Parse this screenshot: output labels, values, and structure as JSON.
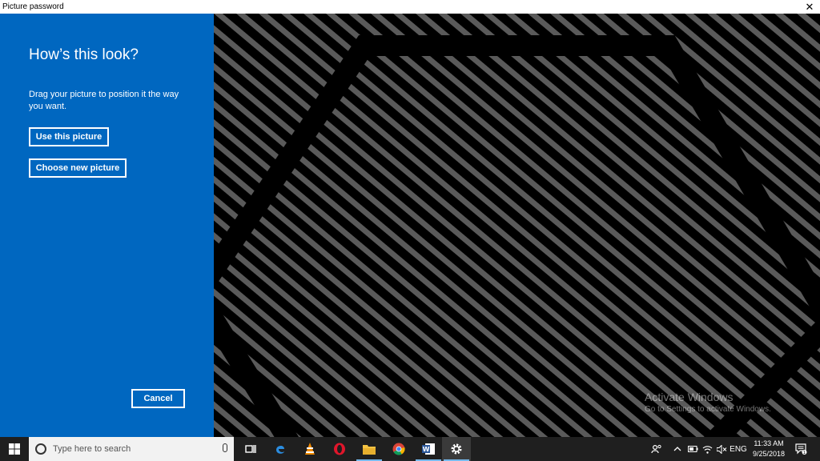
{
  "window": {
    "title": "Picture password"
  },
  "panel": {
    "heading": "How’s this look?",
    "description": "Drag your picture to position it the way you want.",
    "use_button": "Use this picture",
    "choose_button": "Choose new picture",
    "cancel_button": "Cancel"
  },
  "watermark": {
    "line1": "Activate Windows",
    "line2": "Go to Settings to activate Windows."
  },
  "taskbar": {
    "search_placeholder": "Type here to search",
    "language": "ENG",
    "time": "11:33 AM",
    "date": "9/25/2018",
    "notification_count": "1",
    "apps": [
      "task-view-icon",
      "edge-icon",
      "vlc-icon",
      "opera-icon",
      "file-explorer-icon",
      "chrome-icon",
      "word-icon",
      "settings-icon"
    ]
  },
  "colors": {
    "panel": "#0067c0",
    "taskbar": "#1f1f1f",
    "accent": "#76b9ed"
  }
}
